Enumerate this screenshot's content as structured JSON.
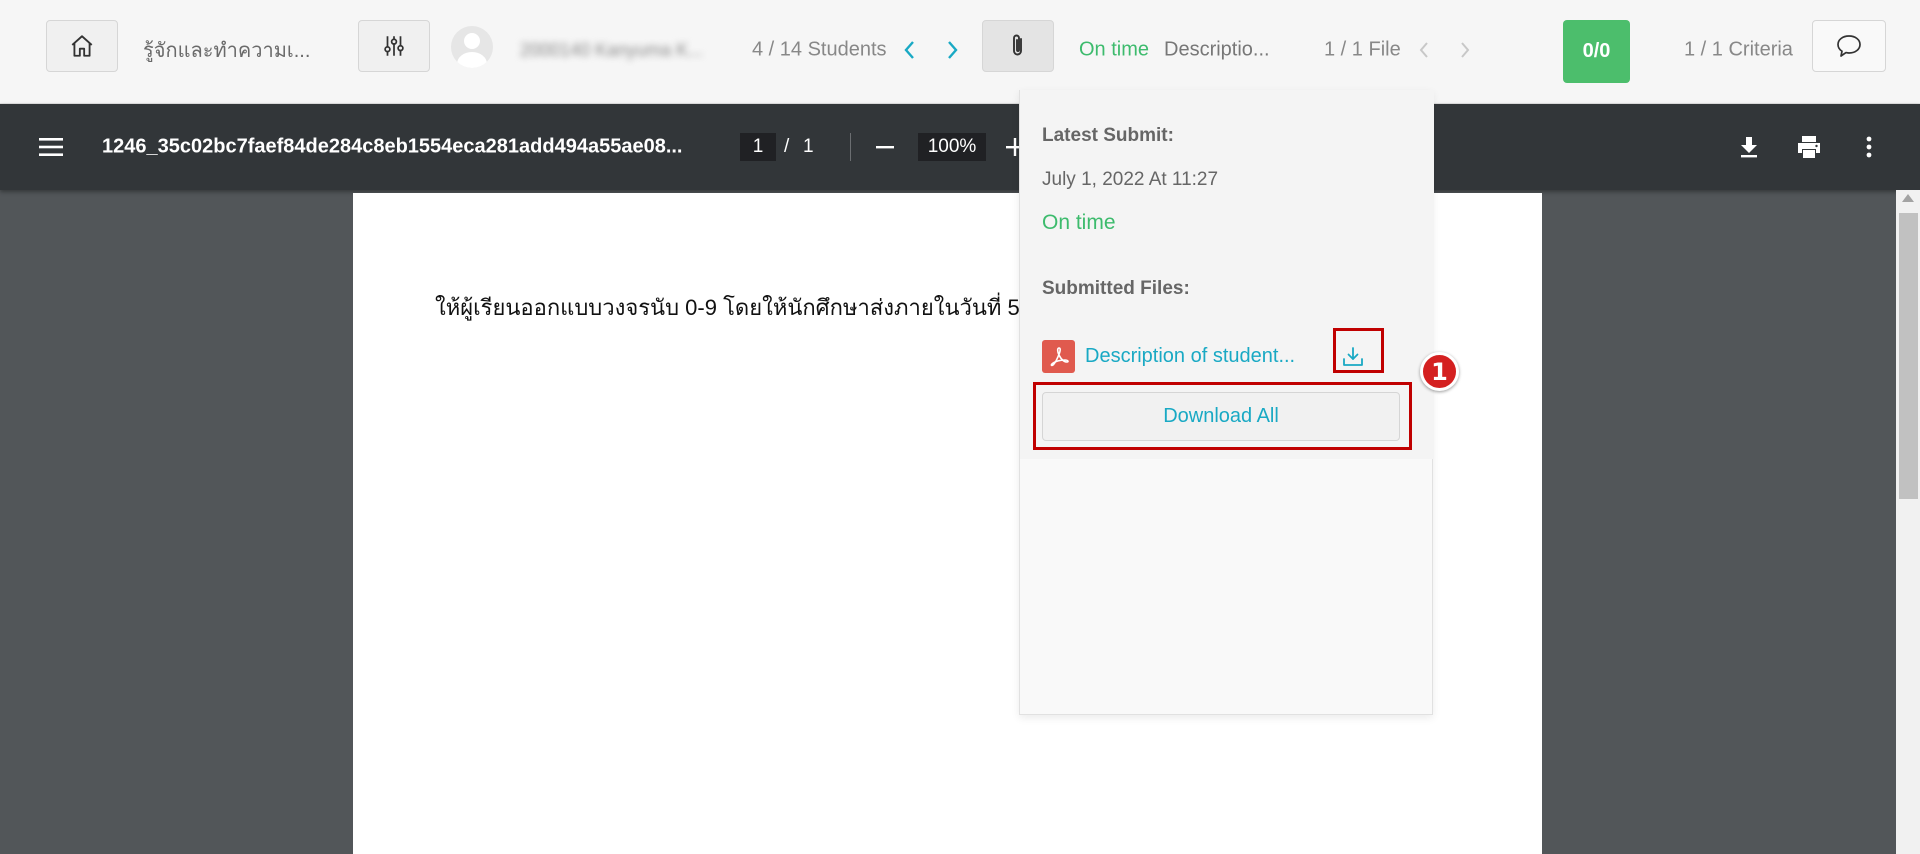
{
  "top_bar": {
    "course_title": "รู้จักและทำความเ...",
    "student_name": "2000140 Kanyuma K...",
    "students_count": "4 / 14 Students",
    "submission_status": "On time",
    "description_title": "Descriptio...",
    "file_count": "1 / 1 File",
    "score": "0/0",
    "criteria": "1 / 1 Criteria"
  },
  "pdf_toolbar": {
    "filename": "1246_35c02bc7faef84de284c8eb1554eca281add494a55ae08...",
    "current_page": "1",
    "page_separator": "/",
    "total_pages": "1",
    "zoom": "100%"
  },
  "document": {
    "text": "ให้ผู้เรียนออกแบบวงจรนับ 0-9  โดยให้นักศึกษาส่งภายในวันที่ 5"
  },
  "popover": {
    "latest_submit_label": "Latest Submit:",
    "submit_date": "July 1, 2022 At 11:27",
    "status": "On time",
    "submitted_files_label": "Submitted Files:",
    "file_name": "Description of student...",
    "download_all_label": "Download All"
  },
  "annotation": {
    "step_number": "1"
  },
  "colors": {
    "accent_teal": "#19a9c4",
    "status_green": "#3dbb6d",
    "score_green": "#4cbe6c",
    "highlight_red": "#c00000",
    "pdf_toolbar": "#323639"
  }
}
